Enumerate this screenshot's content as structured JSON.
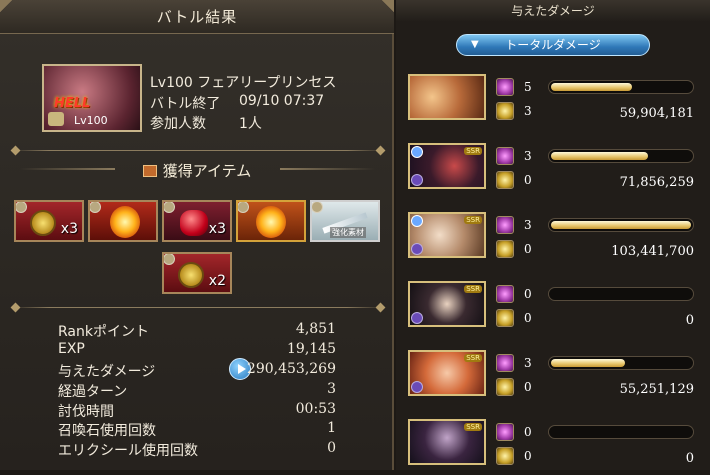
{
  "left": {
    "title": "バトル結果",
    "quest": {
      "badge": "HELL",
      "level": "Lv100"
    },
    "info": {
      "quest_name": "Lv100 フェアリープリンセス",
      "end_label": "バトル終了",
      "end_value": "09/10 07:37",
      "players_label": "参加人数",
      "players_value": "1人"
    },
    "items_title": "獲得アイテム",
    "items": [
      {
        "icon": "gold-medal-icon",
        "count": "x3"
      },
      {
        "icon": "fire-orb-icon",
        "count": ""
      },
      {
        "icon": "red-gem-icon",
        "count": "x3"
      },
      {
        "icon": "flame-orb-icon",
        "count": ""
      },
      {
        "icon": "weapon-icon",
        "count": "",
        "label": "強化素材"
      },
      {
        "icon": "gold-medal-icon",
        "count": "x2"
      }
    ],
    "stats": [
      {
        "label": "Rankポイント",
        "value": "4,851"
      },
      {
        "label": "EXP",
        "value": "19,145"
      },
      {
        "label": "与えたダメージ",
        "value": "290,453,269"
      },
      {
        "label": "経過ターン",
        "value": "3"
      },
      {
        "label": "討伐時間",
        "value": "00:53"
      },
      {
        "label": "召喚石使用回数",
        "value": "1"
      },
      {
        "label": "エリクシール使用回数",
        "value": "0"
      }
    ]
  },
  "right": {
    "title": "与えたダメージ",
    "tab_label": "トータルダメージ",
    "rows": [
      {
        "ca": "5",
        "ability": "3",
        "damage": "59,904,181",
        "share": 0.58
      },
      {
        "ca": "3",
        "ability": "0",
        "damage": "71,856,259",
        "share": 0.69
      },
      {
        "ca": "3",
        "ability": "0",
        "damage": "103,441,700",
        "share": 1.0
      },
      {
        "ca": "0",
        "ability": "0",
        "damage": "0",
        "share": 0
      },
      {
        "ca": "3",
        "ability": "0",
        "damage": "55,251,129",
        "share": 0.53
      },
      {
        "ca": "0",
        "ability": "0",
        "damage": "0",
        "share": 0
      }
    ]
  }
}
